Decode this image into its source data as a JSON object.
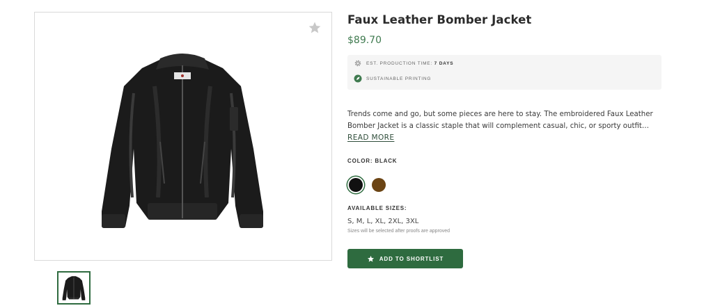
{
  "product": {
    "title": "Faux Leather Bomber Jacket",
    "price": "$89.70",
    "image_icon": "jacket-image",
    "favorite_icon": "star-icon"
  },
  "info_box": {
    "production_label": "EST. PRODUCTION TIME:",
    "production_value": "7 DAYS",
    "production_icon": "gear-icon",
    "sustainable_label": "SUSTAINABLE PRINTING",
    "sustainable_icon": "leaf-icon"
  },
  "description": {
    "text": "Trends come and go, but some pieces are here to stay. The embroidered Faux Leather Bomber Jacket is a classic staple that will complement casual, chic, or sporty outfit…",
    "read_more": "READ MORE"
  },
  "color": {
    "label": "COLOR: BLACK",
    "swatches": [
      {
        "name": "Black",
        "hex": "#111111",
        "selected": true
      },
      {
        "name": "Brown",
        "hex": "#6b4414",
        "selected": false
      }
    ]
  },
  "sizes": {
    "label": "AVAILABLE SIZES:",
    "values": "S, M, L, XL, 2XL, 3XL",
    "note": "Sizes will be selected after proofs are approved"
  },
  "cta": {
    "label": "ADD TO SHORTLIST",
    "icon": "star-icon"
  },
  "colors": {
    "accent": "#2e6b3f",
    "price": "#3f7a4f"
  }
}
